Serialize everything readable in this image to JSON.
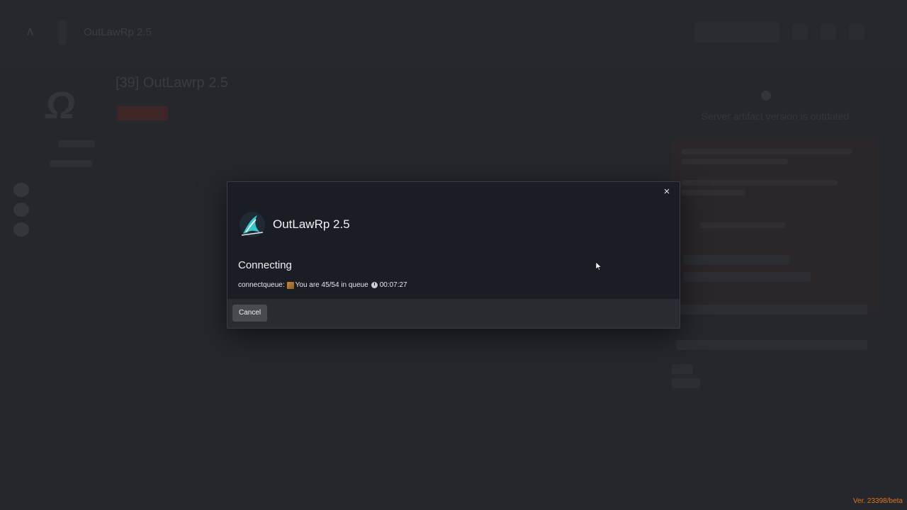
{
  "background": {
    "topbar_title": "OutLawRp 2.5",
    "server_title": "[39] OutLawrp 2.5",
    "notice_title": "Server artifact version is outdated"
  },
  "modal": {
    "server_name": "OutLawRp 2.5",
    "status": "Connecting",
    "queue": {
      "prefix": "connectqueue:",
      "position_text": "You are 45/54 in queue",
      "timer": "00:07:27"
    },
    "cancel_label": "Cancel",
    "close_icon": "×"
  },
  "footer": {
    "version": "Ver. 23398/beta"
  },
  "colors": {
    "accent_version": "#e07820",
    "logo_teal": "#39c6c9",
    "modal_bg": "#1b1d25"
  }
}
